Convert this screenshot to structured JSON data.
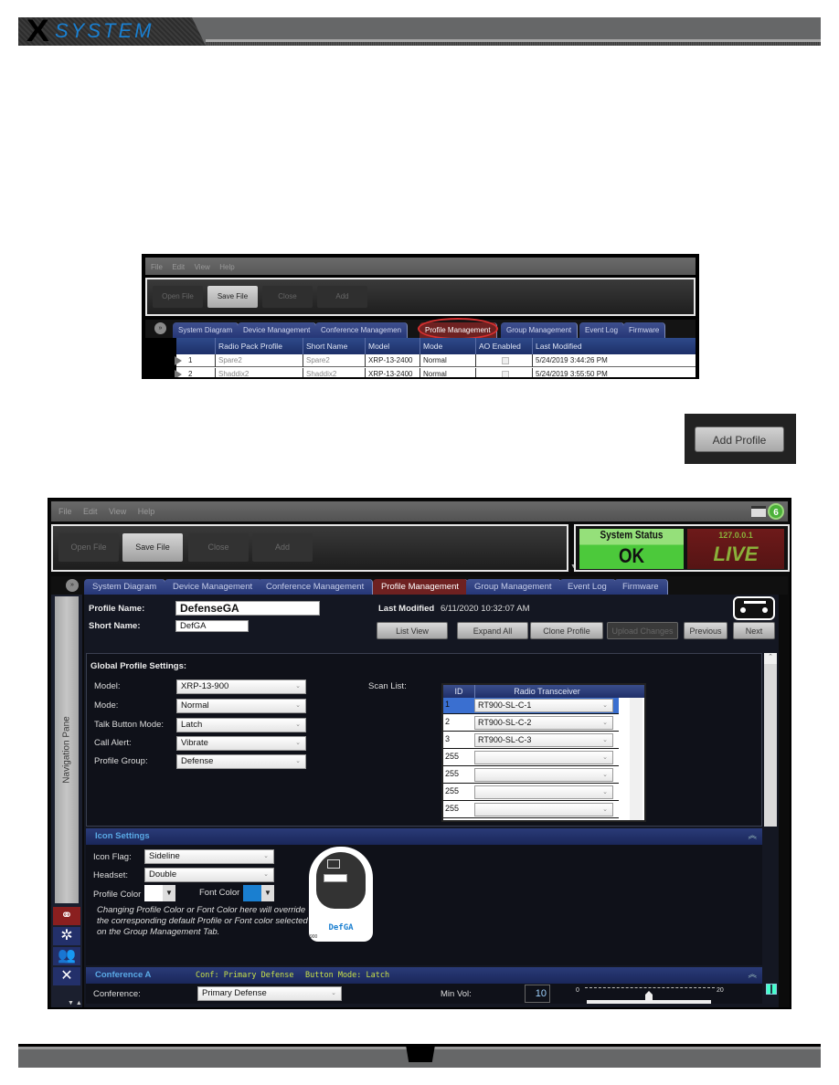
{
  "header": {
    "logo_x": "X",
    "logo_text": "SYSTEM"
  },
  "small_screenshot": {
    "menu": [
      "File",
      "Edit",
      "View",
      "Help"
    ],
    "toolbar": [
      "Open File",
      "Save File",
      "Close",
      "Add"
    ],
    "tabs": [
      "System Diagram",
      "Device Management",
      "Conference Managemen",
      "Profile Management",
      "Group Management",
      "Event Log",
      "Firmware"
    ],
    "active_tab": "Profile Management",
    "columns": [
      "Radio Pack Profile",
      "Short Name",
      "Model",
      "Mode",
      "AO Enabled",
      "Last Modified"
    ],
    "rows": [
      {
        "index": "1",
        "profile": "Spare2",
        "short": "Spare2",
        "model": "XRP-13-2400",
        "mode": "Normal",
        "ao": false,
        "modified": "5/24/2019 3:44:26 PM"
      },
      {
        "index": "2",
        "profile": "Shaddix2",
        "short": "Shaddix2",
        "model": "XRP-13-2400",
        "mode": "Normal",
        "ao": false,
        "modified": "5/24/2019 3:55:50 PM"
      }
    ]
  },
  "add_profile_button": "Add Profile",
  "app": {
    "menu": [
      "File",
      "Edit",
      "View",
      "Help"
    ],
    "toolbar": [
      "Open File",
      "Save File",
      "Close",
      "Add"
    ],
    "status": {
      "title": "System Status",
      "value": "OK",
      "ip": "127.0.0.1",
      "mode": "LIVE",
      "ok_color": "#4cc93b",
      "live_color": "#6e1a1a"
    },
    "tabs": [
      "System Diagram",
      "Device Management",
      "Conference Management",
      "Profile Management",
      "Group Management",
      "Event Log",
      "Firmware"
    ],
    "active_tab": "Profile Management",
    "nav_pane_label": "Navigation Pane",
    "profile": {
      "name_label": "Profile Name:",
      "name_value": "DefenseGA",
      "short_label": "Short Name:",
      "short_value": "DefGA",
      "last_modified_label": "Last Modified",
      "last_modified_value": "6/11/2020 10:32:07 AM"
    },
    "actions": [
      "List View",
      "Expand All",
      "Clone Profile",
      "Upload Changes",
      "Previous",
      "Next"
    ],
    "global": {
      "title": "Global Profile Settings:",
      "fields": [
        {
          "label": "Model:",
          "value": "XRP-13-900"
        },
        {
          "label": "Mode:",
          "value": "Normal"
        },
        {
          "label": "Talk Button Mode:",
          "value": "Latch"
        },
        {
          "label": "Call Alert:",
          "value": "Vibrate"
        },
        {
          "label": "Profile Group:",
          "value": "Defense"
        }
      ],
      "scan_list_label": "Scan List:",
      "scan_columns": [
        "ID",
        "Radio Transceiver"
      ],
      "scan_rows": [
        {
          "id": "1",
          "value": "RT900-SL-C-1"
        },
        {
          "id": "2",
          "value": "RT900-SL-C-2"
        },
        {
          "id": "3",
          "value": "RT900-SL-C-3"
        },
        {
          "id": "255",
          "value": ""
        },
        {
          "id": "255",
          "value": ""
        },
        {
          "id": "255",
          "value": ""
        },
        {
          "id": "255",
          "value": ""
        }
      ]
    },
    "icon_settings": {
      "title": "Icon Settings",
      "icon_flag_label": "Icon Flag:",
      "icon_flag_value": "Sideline",
      "headset_label": "Headset:",
      "headset_value": "Double",
      "profile_color_label": "Profile Color",
      "profile_color": "#ffffff",
      "font_color_label": "Font Color",
      "font_color": "#1a7fd0",
      "hint": "Changing Profile Color or Font Color here will override the corresponding default Profile or Font color selected on the Group Management Tab.",
      "preview_name": "DefGA",
      "preview_model": "900"
    },
    "conference_a": {
      "title": "Conference A",
      "conf_summary": "Conf: Primary Defense",
      "button_summary": "Button Mode: Latch",
      "conference_label": "Conference:",
      "conference_value": "Primary Defense",
      "min_vol_label": "Min Vol:",
      "min_vol_value": "10",
      "slider_min": "0",
      "slider_max": "20",
      "slider_value": 10
    }
  }
}
